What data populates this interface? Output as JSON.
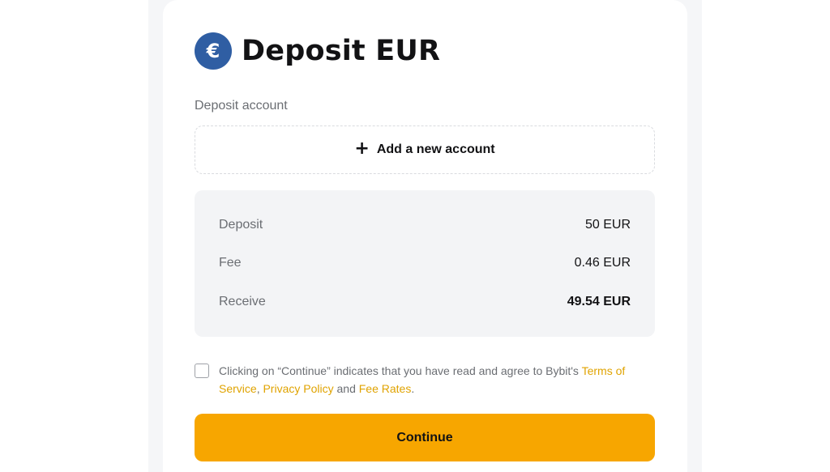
{
  "header": {
    "icon": "euro-coin-icon",
    "icon_glyph": "€",
    "title": "Deposit EUR"
  },
  "deposit_account": {
    "label": "Deposit account",
    "add_icon": "+",
    "add_label": "Add a new account"
  },
  "summary": {
    "rows": [
      {
        "label": "Deposit",
        "value": "50 EUR"
      },
      {
        "label": "Fee",
        "value": "0.46 EUR"
      },
      {
        "label": "Receive",
        "value": "49.54 EUR"
      }
    ]
  },
  "agreement": {
    "checked": false,
    "text_before": "Clicking on “Continue” indicates that you have read and agree to Bybit's ",
    "terms_link": "Terms of Service",
    "sep_comma": ", ",
    "privacy_link": "Privacy Policy",
    "and_text": " and ",
    "fee_link": "Fee Rates",
    "period": "."
  },
  "continue_button": {
    "label": "Continue"
  },
  "colors": {
    "accent": "#f7a600",
    "link": "#e0a300",
    "coin": "#2f5ea3"
  }
}
